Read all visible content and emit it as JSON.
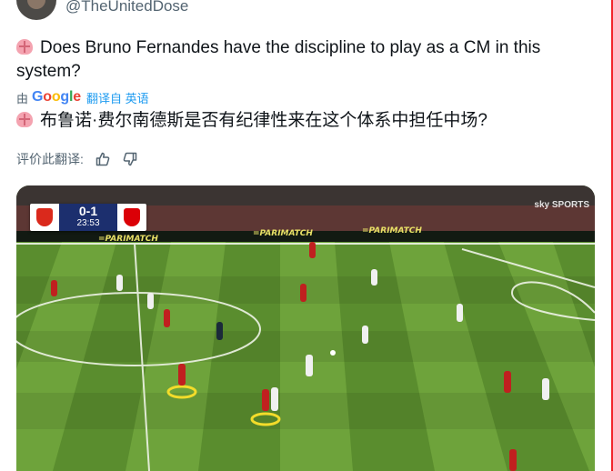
{
  "tweet": {
    "handle": "@TheUnitedDose",
    "original_text": "Does Bruno Fernandes have the discipline to play as a CM in this system?",
    "translated_text": "布鲁诺·费尔南德斯是否有纪律性来在这个体系中担任中场?",
    "emoji_icon": "brain-emoji"
  },
  "translation": {
    "by_prefix": "由",
    "google_letters": [
      "G",
      "o",
      "o",
      "g",
      "l",
      "e"
    ],
    "link_label": "翻译自 英语"
  },
  "rating": {
    "label": "评价此翻译:",
    "up_icon": "thumbs-up-icon",
    "down_icon": "thumbs-down-icon"
  },
  "media": {
    "scorebug": {
      "home_color": "#da291c",
      "score": "0-1",
      "time": "23:53",
      "away_color": "#db0007"
    },
    "broadcaster": "sky SPORTS"
  },
  "colors": {
    "link": "#1d9bf0",
    "secondary_text": "#536471",
    "pitch_light": "#6ea33b",
    "pitch_dark": "#5a8d2e"
  }
}
